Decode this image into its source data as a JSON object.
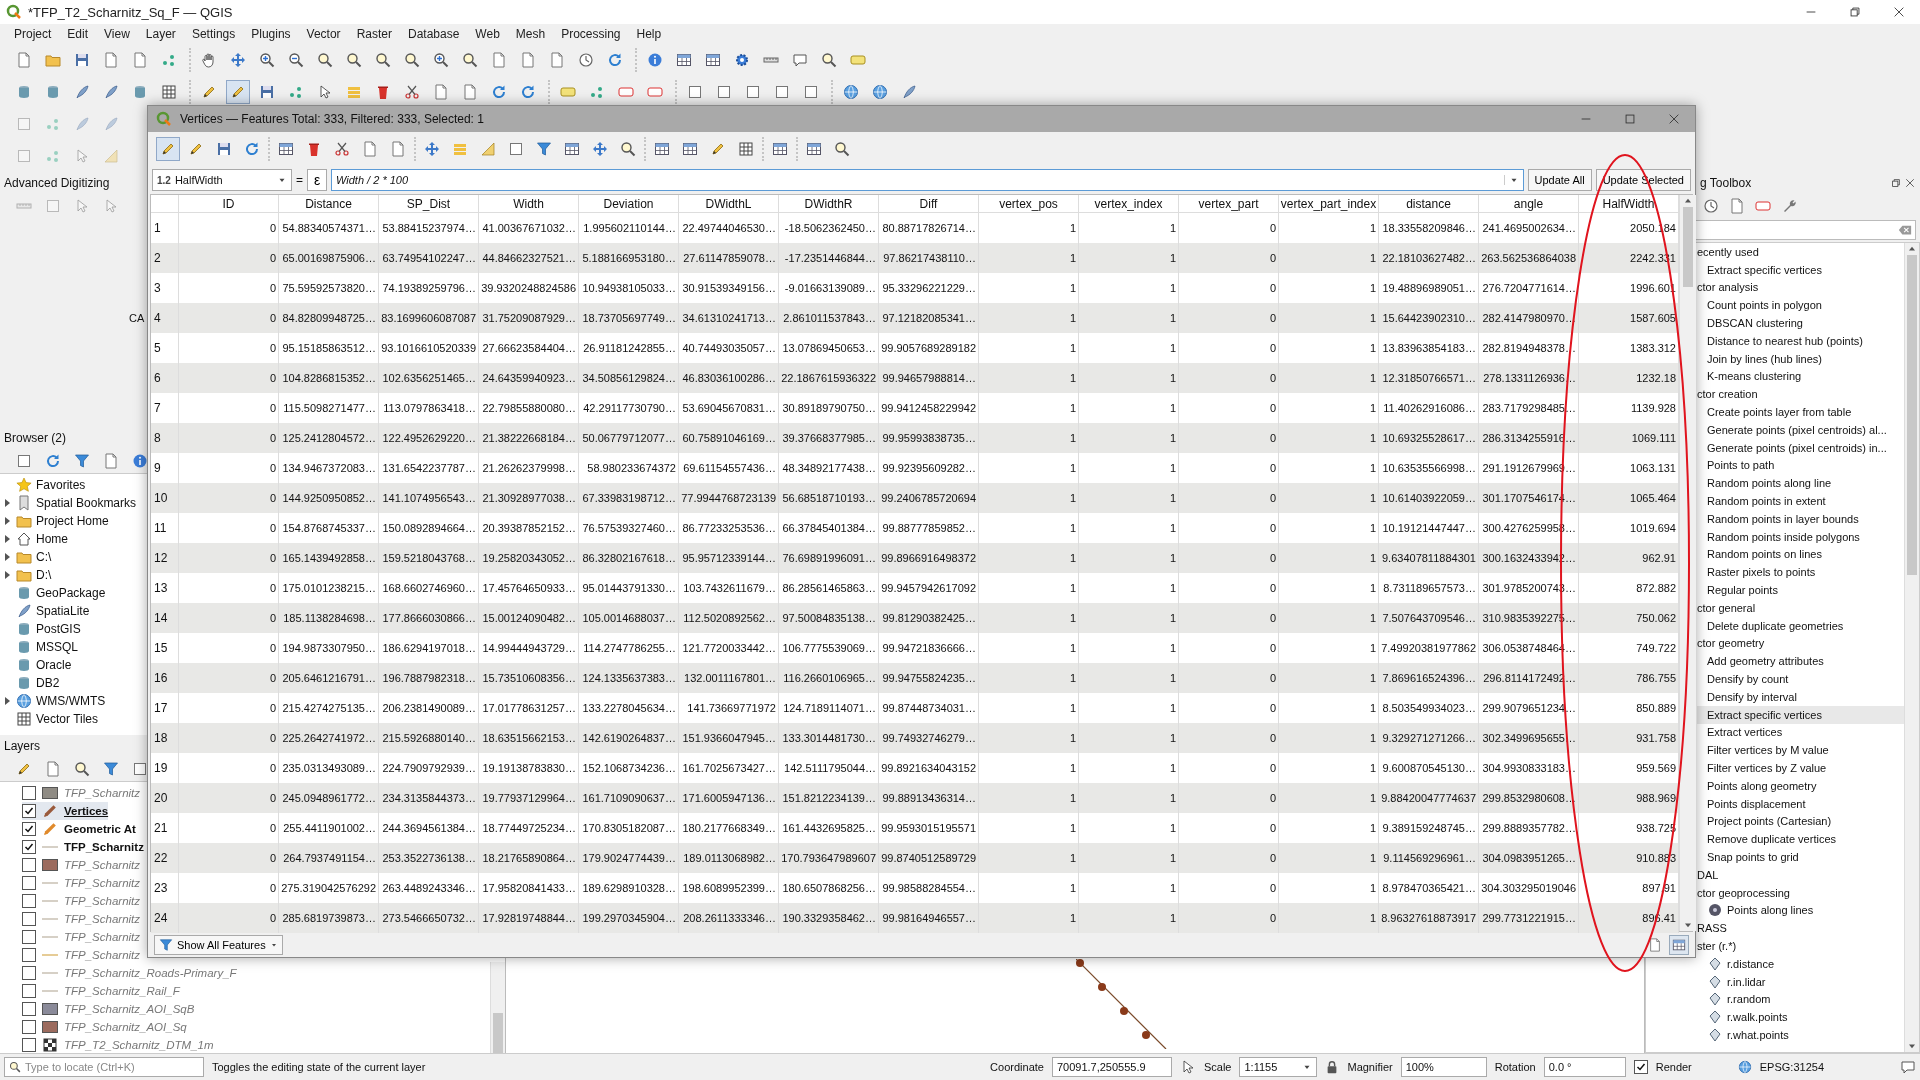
{
  "app_title": "*TFP_T2_Scharnitz_Sq_F — QGIS",
  "menu": [
    "Project",
    "Edit",
    "View",
    "Layer",
    "Settings",
    "Plugins",
    "Vector",
    "Raster",
    "Database",
    "Web",
    "Mesh",
    "Processing",
    "Help"
  ],
  "advanced_digitizing": {
    "title": "Advanced Digitizing",
    "label": "CA"
  },
  "browser": {
    "title": "Browser (2)",
    "items": [
      {
        "label": "Favorites",
        "expandable": false
      },
      {
        "label": "Spatial Bookmarks",
        "expandable": true
      },
      {
        "label": "Project Home",
        "expandable": true
      },
      {
        "label": "Home",
        "expandable": true
      },
      {
        "label": "C:\\",
        "expandable": true
      },
      {
        "label": "D:\\",
        "expandable": true
      },
      {
        "label": "GeoPackage",
        "expandable": false
      },
      {
        "label": "SpatiaLite",
        "expandable": false
      },
      {
        "label": "PostGIS",
        "expandable": false
      },
      {
        "label": "MSSQL",
        "expandable": false
      },
      {
        "label": "Oracle",
        "expandable": false
      },
      {
        "label": "DB2",
        "expandable": false
      },
      {
        "label": "WMS/WMTS",
        "expandable": true
      },
      {
        "label": "Vector Tiles",
        "expandable": false
      }
    ]
  },
  "layers": {
    "title": "Layers",
    "items": [
      {
        "label": "TFP_Scharnitz",
        "kind": "polygon",
        "color": "#8f8b84",
        "checked": false,
        "selected": false
      },
      {
        "label": "Vertices",
        "kind": "point_edit",
        "color": "#9a5a3c",
        "checked": true,
        "selected": true
      },
      {
        "label": "Geometric At",
        "kind": "point_edit",
        "color": "#e08a2c",
        "checked": true,
        "selected": false
      },
      {
        "label": "TFP_Scharnitz",
        "kind": "line",
        "color": "#d6d0c6",
        "checked": true,
        "selected": false
      },
      {
        "label": "TFP_Scharnitz",
        "kind": "polygon",
        "color": "#9c6b5e",
        "checked": false,
        "selected": false
      },
      {
        "label": "TFP_Scharnitz",
        "kind": "line",
        "color": "#d6d0c6",
        "checked": false,
        "selected": false
      },
      {
        "label": "TFP_Scharnitz",
        "kind": "line",
        "color": "#d6d0c6",
        "checked": false,
        "selected": false
      },
      {
        "label": "TFP_Scharnitz",
        "kind": "line",
        "color": "#d6d0c6",
        "checked": false,
        "selected": false
      },
      {
        "label": "TFP_Scharnitz",
        "kind": "line",
        "color": "#d6d0c6",
        "checked": false,
        "selected": false
      },
      {
        "label": "TFP_Scharnitz",
        "kind": "line",
        "color": "#e6cc96",
        "checked": false,
        "selected": false
      },
      {
        "label": "TFP_Scharnitz_Roads-Primary_F",
        "kind": "line",
        "color": "#d6d0c6",
        "checked": false,
        "selected": false
      },
      {
        "label": "TFP_Scharnitz_Rail_F",
        "kind": "line",
        "color": "#d6d0c6",
        "checked": false,
        "selected": false
      },
      {
        "label": "TFP_Scharnitz_AOI_SqB",
        "kind": "polygon",
        "color": "#8a8a99",
        "checked": false,
        "selected": false
      },
      {
        "label": "TFP_Scharnitz_AOI_Sq",
        "kind": "polygon",
        "color": "#9c6b5e",
        "checked": false,
        "selected": false
      },
      {
        "label": "TFP_T2_Scharnitz_DTM_1m",
        "kind": "raster",
        "checked": false,
        "selected": false
      }
    ]
  },
  "attribute_table": {
    "title": "Vertices — Features Total: 333, Filtered: 333, Selected: 1",
    "editing_on": true,
    "field_combo": {
      "type_badge": "1.2",
      "value": "HalfWidth"
    },
    "equals": "=",
    "expression_button": "ε",
    "expression": "Width / 2 * 100",
    "buttons": [
      "Update All",
      "Update Selected"
    ],
    "columns": [
      "ID",
      "Distance",
      "SP_Dist",
      "Width",
      "Deviation",
      "DWidthL",
      "DWidthR",
      "Diff",
      "vertex_pos",
      "vertex_index",
      "vertex_part",
      "vertex_part_index",
      "distance",
      "angle",
      "HalfWidth"
    ],
    "rows": [
      {
        "n": "1",
        "cells": [
          "0",
          "54.88340574371…",
          "53.88415237974…",
          "41.00367671032…",
          "1.995602110144…",
          "22.49744046530…",
          "-18.5062362450…",
          "80.88717826714…",
          "1",
          "1",
          "0",
          "1",
          "18.33558209846…",
          "241.4695002634…",
          "2050.184"
        ]
      },
      {
        "n": "2",
        "cells": [
          "0",
          "65.00169875906…",
          "63.74954102247…",
          "44.84662327521…",
          "5.188166953180…",
          "27.61147859078…",
          "-17.2351446844…",
          "97.86217438110…",
          "1",
          "1",
          "0",
          "1",
          "22.18103627482…",
          "263.562536864038",
          "2242.331"
        ]
      },
      {
        "n": "3",
        "cells": [
          "0",
          "75.59592573820…",
          "74.19389259796…",
          "39.9320248824586",
          "10.94938105033…",
          "30.91539349156…",
          "-9.01663139089…",
          "95.33296221229…",
          "1",
          "1",
          "0",
          "1",
          "19.48896989051…",
          "276.7204771614…",
          "1996.601"
        ]
      },
      {
        "n": "4",
        "cells": [
          "0",
          "84.82809948725…",
          "83.1699606087087",
          "31.75209087929…",
          "18.73705697749…",
          "34.61310241713…",
          "2.861011537843…",
          "97.12182085341…",
          "1",
          "1",
          "0",
          "1",
          "15.64423902310…",
          "282.4147980970…",
          "1587.605"
        ]
      },
      {
        "n": "5",
        "cells": [
          "0",
          "95.15185863512…",
          "93.1016610520339",
          "27.66623584404…",
          "26.91181242855…",
          "40.74493035057…",
          "13.07869450653…",
          "99.9057689289182",
          "1",
          "1",
          "0",
          "1",
          "13.83963854183…",
          "282.8194948378…",
          "1383.312"
        ]
      },
      {
        "n": "6",
        "cells": [
          "0",
          "104.8286815352…",
          "102.6356251465…",
          "24.64359940923…",
          "34.50856129824…",
          "46.83036100286…",
          "22.1867615936322",
          "99.94657988814…",
          "1",
          "1",
          "0",
          "1",
          "12.31850766571…",
          "278.1331126936…",
          "1232.18"
        ]
      },
      {
        "n": "7",
        "cells": [
          "0",
          "115.5098271477…",
          "113.0797863418…",
          "22.79855880080…",
          "42.29117730790…",
          "53.69045670831…",
          "30.89189790750…",
          "99.9412458229942",
          "1",
          "1",
          "0",
          "1",
          "11.40262916086…",
          "283.7179298485…",
          "1139.928"
        ]
      },
      {
        "n": "8",
        "cells": [
          "0",
          "125.2412804572…",
          "122.4952629220…",
          "21.38222668184…",
          "50.06779712077…",
          "60.75891046169…",
          "39.37668377985…",
          "99.95993838735…",
          "1",
          "1",
          "0",
          "1",
          "10.69325528617…",
          "286.3134255916…",
          "1069.111"
        ]
      },
      {
        "n": "9",
        "cells": [
          "0",
          "134.9467372083…",
          "131.6542237787…",
          "21.26262379998…",
          "58.980233674372",
          "69.61154557436…",
          "48.34892177438…",
          "99.92395609282…",
          "1",
          "1",
          "0",
          "1",
          "10.63535566998…",
          "291.1912679969…",
          "1063.131"
        ]
      },
      {
        "n": "10",
        "cells": [
          "0",
          "144.9250950852…",
          "141.1074956543…",
          "21.30928977038…",
          "67.33983198712…",
          "77.9944768723139",
          "56.68518710193…",
          "99.2406785720694",
          "1",
          "1",
          "0",
          "1",
          "10.61403922059…",
          "301.1707546174…",
          "1065.464"
        ]
      },
      {
        "n": "11",
        "cells": [
          "0",
          "154.8768745337…",
          "150.0892894664…",
          "20.39387852152…",
          "76.57539327460…",
          "86.77233253536…",
          "66.37845401384…",
          "99.88777859852…",
          "1",
          "1",
          "0",
          "1",
          "10.19121447447…",
          "300.4276259958…",
          "1019.694"
        ]
      },
      {
        "n": "12",
        "cells": [
          "0",
          "165.1439492858…",
          "159.5218043768…",
          "19.25820343052…",
          "86.32802167618…",
          "95.95712339144…",
          "76.69891996091…",
          "99.8966916498372",
          "1",
          "1",
          "0",
          "1",
          "9.63407811884301",
          "300.1632433942…",
          "962.91"
        ]
      },
      {
        "n": "13",
        "cells": [
          "0",
          "175.0101238215…",
          "168.6602746960…",
          "17.45764650933…",
          "95.01443791330…",
          "103.7432611679…",
          "86.28561465863…",
          "99.9457942617092",
          "1",
          "1",
          "0",
          "1",
          "8.731189657573…",
          "301.9785200743…",
          "872.882"
        ]
      },
      {
        "n": "14",
        "cells": [
          "0",
          "185.1138284698…",
          "177.8666030866…",
          "15.00124090482…",
          "105.0014688037…",
          "112.5020892562…",
          "97.50084835138…",
          "99.81290382425…",
          "1",
          "1",
          "0",
          "1",
          "7.507643709546…",
          "310.9835392275…",
          "750.062"
        ]
      },
      {
        "n": "15",
        "cells": [
          "0",
          "194.9873307950…",
          "186.6294197018…",
          "14.99444943729…",
          "114.2747786255…",
          "121.7720033442…",
          "106.7775539069…",
          "99.94721836666…",
          "1",
          "1",
          "0",
          "1",
          "7.49920381977862",
          "306.0538748464…",
          "749.722"
        ]
      },
      {
        "n": "16",
        "cells": [
          "0",
          "205.6461216791…",
          "196.7887982318…",
          "15.73510608356…",
          "124.1335637383…",
          "132.0011167801…",
          "116.2660106965…",
          "99.94755824235…",
          "1",
          "1",
          "0",
          "1",
          "7.869616524396…",
          "296.8114172492…",
          "786.755"
        ]
      },
      {
        "n": "17",
        "cells": [
          "0",
          "215.4274275135…",
          "206.2381490089…",
          "17.01778631257…",
          "133.2278045634…",
          "141.73669771972",
          "124.7189114071…",
          "99.87448734031…",
          "1",
          "1",
          "0",
          "1",
          "8.503549934023…",
          "299.9079651234…",
          "850.889"
        ]
      },
      {
        "n": "18",
        "cells": [
          "0",
          "225.2642741972…",
          "215.5926880140…",
          "18.63515662153…",
          "142.6190264837…",
          "151.9366047945…",
          "133.3014481730…",
          "99.74932746279…",
          "1",
          "1",
          "0",
          "1",
          "9.329271271266…",
          "302.3499695655…",
          "931.758"
        ]
      },
      {
        "n": "19",
        "cells": [
          "0",
          "235.0313493089…",
          "224.7909792939…",
          "19.19138783830…",
          "152.1068734236…",
          "161.7025673427…",
          "142.5111795044…",
          "99.8921634043152",
          "1",
          "1",
          "0",
          "1",
          "9.600870545130…",
          "304.9930833183…",
          "959.569"
        ]
      },
      {
        "n": "20",
        "cells": [
          "0",
          "245.0948961772…",
          "234.3135844373…",
          "19.77937129964…",
          "161.7109090637…",
          "171.6005947136…",
          "151.8212234139…",
          "99.88913436314…",
          "1",
          "1",
          "0",
          "1",
          "9.88420047774637",
          "299.8532980608…",
          "988.969"
        ]
      },
      {
        "n": "21",
        "cells": [
          "0",
          "255.4411901002…",
          "244.3694561384…",
          "18.77449725234…",
          "170.8305182087…",
          "180.2177668349…",
          "161.4432695825…",
          "99.9593015195571",
          "1",
          "1",
          "0",
          "1",
          "9.389159248745…",
          "299.8889357782…",
          "938.725"
        ]
      },
      {
        "n": "22",
        "cells": [
          "0",
          "264.7937491154…",
          "253.3522736138…",
          "18.21765890864…",
          "179.9024774439…",
          "189.0113068982…",
          "170.793647989607",
          "99.8740512589729",
          "1",
          "1",
          "0",
          "1",
          "9.114569296961…",
          "304.0983951265…",
          "910.883"
        ]
      },
      {
        "n": "23",
        "cells": [
          "0",
          "275.319042576292",
          "263.4489243346…",
          "17.95820841433…",
          "189.6298910328…",
          "198.6089952399…",
          "180.6507868256…",
          "99.98588284554…",
          "1",
          "1",
          "0",
          "1",
          "8.978470365421…",
          "304.303295019046",
          "897.91"
        ]
      },
      {
        "n": "24",
        "cells": [
          "0",
          "285.6819739873…",
          "273.5466650732…",
          "17.92819748844…",
          "199.2970345904…",
          "208.2611333346…",
          "190.3329358462…",
          "99.98164946557…",
          "1",
          "1",
          "0",
          "1",
          "8.96327618873917",
          "299.7731221915…",
          "896.41"
        ]
      }
    ],
    "show_all_button": "Show All Features"
  },
  "toolbox": {
    "title": "g Toolbox",
    "items": [
      {
        "label": "ecently used",
        "children": [
          {
            "label": "Extract specific vertices",
            "selected": false
          }
        ]
      },
      {
        "label": "ctor analysis",
        "children": [
          {
            "label": "Count points in polygon",
            "selected": false
          },
          {
            "label": "DBSCAN clustering",
            "selected": false
          },
          {
            "label": "Distance to nearest hub (points)",
            "selected": false
          },
          {
            "label": "Join by lines (hub lines)",
            "selected": false
          },
          {
            "label": "K-means clustering",
            "selected": false
          }
        ]
      },
      {
        "label": "ctor creation",
        "children": [
          {
            "label": "Create points layer from table",
            "selected": false
          },
          {
            "label": "Generate points (pixel centroids) al...",
            "selected": false
          },
          {
            "label": "Generate points (pixel centroids) in...",
            "selected": false
          },
          {
            "label": "Points to path",
            "selected": false
          },
          {
            "label": "Random points along line",
            "selected": false
          },
          {
            "label": "Random points in extent",
            "selected": false
          },
          {
            "label": "Random points in layer bounds",
            "selected": false
          },
          {
            "label": "Random points inside polygons",
            "selected": false
          },
          {
            "label": "Random points on lines",
            "selected": false
          },
          {
            "label": "Raster pixels to points",
            "selected": false
          },
          {
            "label": "Regular points",
            "selected": false
          }
        ]
      },
      {
        "label": "ctor general",
        "children": [
          {
            "label": "Delete duplicate geometries",
            "selected": false
          }
        ]
      },
      {
        "label": "ctor geometry",
        "children": [
          {
            "label": "Add geometry attributes",
            "selected": false
          },
          {
            "label": "Densify by count",
            "selected": false
          },
          {
            "label": "Densify by interval",
            "selected": false
          },
          {
            "label": "Extract specific vertices",
            "selected": true
          },
          {
            "label": "Extract vertices",
            "selected": false
          },
          {
            "label": "Filter vertices by M value",
            "selected": false
          },
          {
            "label": "Filter vertices by Z value",
            "selected": false
          },
          {
            "label": "Points along geometry",
            "selected": false
          },
          {
            "label": "Points displacement",
            "selected": false
          },
          {
            "label": "Project points (Cartesian)",
            "selected": false
          },
          {
            "label": "Remove duplicate vertices",
            "selected": false
          },
          {
            "label": "Snap points to grid",
            "selected": false
          }
        ]
      },
      {
        "label": "DAL",
        "children": [
          {
            "label": "ctor geoprocessing",
            "children": [
              {
                "label": "Points along lines",
                "kind": "gdal",
                "selected": false
              }
            ]
          }
        ]
      },
      {
        "label": "RASS",
        "children": [
          {
            "label": "ster (r.*)",
            "children": [
              {
                "label": "r.distance",
                "kind": "grass",
                "selected": false
              },
              {
                "label": "r.in.lidar",
                "kind": "grass",
                "selected": false
              },
              {
                "label": "r.random",
                "kind": "grass",
                "selected": false
              },
              {
                "label": "r.walk.points",
                "kind": "grass",
                "selected": false
              },
              {
                "label": "r.what.points",
                "kind": "grass",
                "selected": false
              }
            ]
          }
        ]
      }
    ]
  },
  "status_bar": {
    "locate_placeholder": "Type to locate (Ctrl+K)",
    "message": "Toggles the editing state of the current layer",
    "coordinate_label": "Coordinate",
    "coordinate": "70091.7,250555.9",
    "scale_label": "Scale",
    "scale": "1:1155",
    "magnifier_label": "Magnifier",
    "magnifier": "100%",
    "rotation_label": "Rotation",
    "rotation": "0.0 °",
    "render_label": "Render",
    "render_checked": true,
    "crs": "EPSG:31254"
  }
}
